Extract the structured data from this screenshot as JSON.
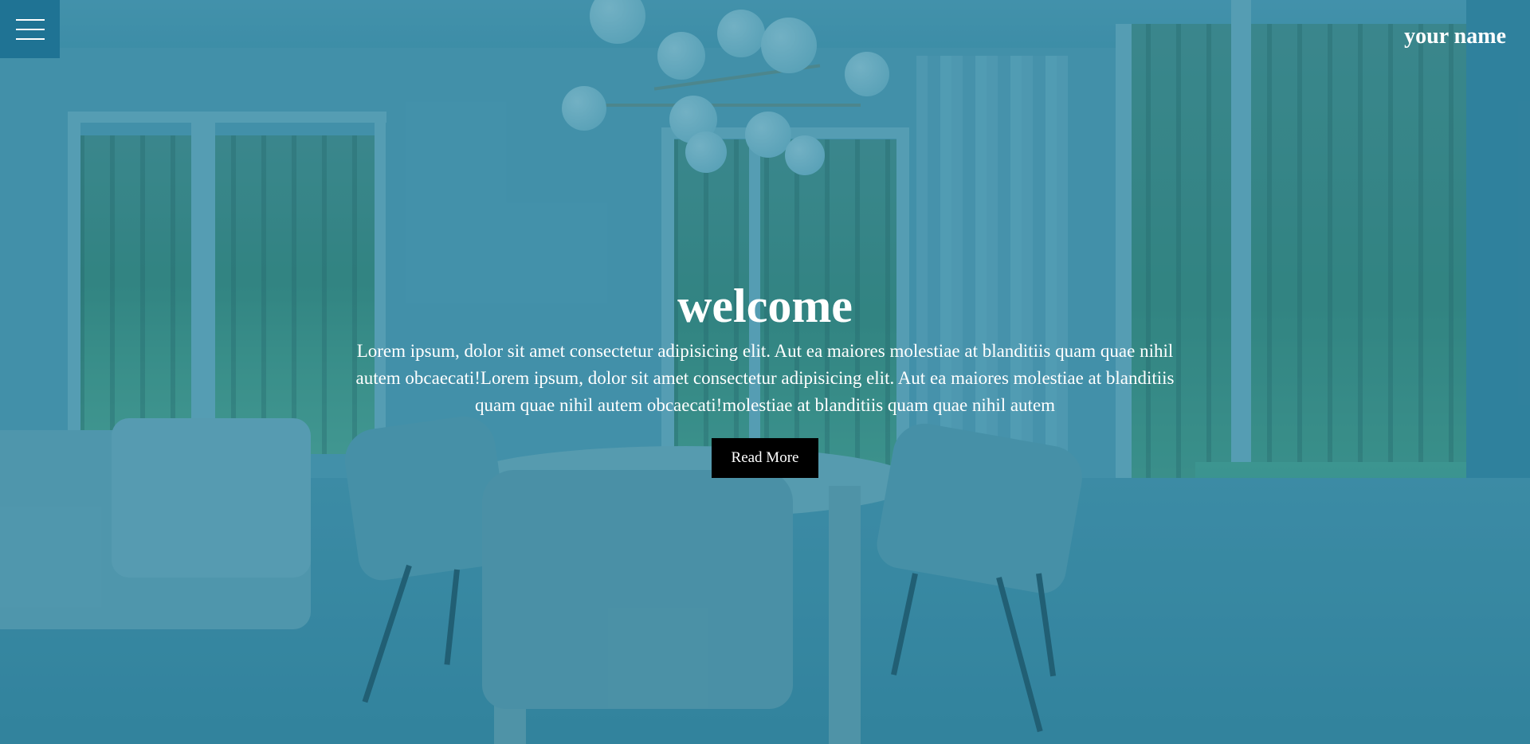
{
  "header": {
    "brand": "your name",
    "menu_icon": "hamburger-menu-icon"
  },
  "hero": {
    "title": "welcome",
    "description": "Lorem ipsum, dolor sit amet consectetur adipisicing elit. Aut ea maiores molestiae at blanditiis quam quae nihil autem obcaecati!Lorem ipsum, dolor sit amet consectetur adipisicing elit. Aut ea maiores molestiae at blanditiis quam quae nihil autem obcaecati!molestiae at blanditiis quam quae nihil autem",
    "button_label": "Read More",
    "background": "interior dining room photo with blue-teal overlay"
  },
  "colors": {
    "overlay": "#1d7a99",
    "menu_bg": "#1f7394",
    "button_bg": "#000000",
    "text": "#ffffff"
  }
}
